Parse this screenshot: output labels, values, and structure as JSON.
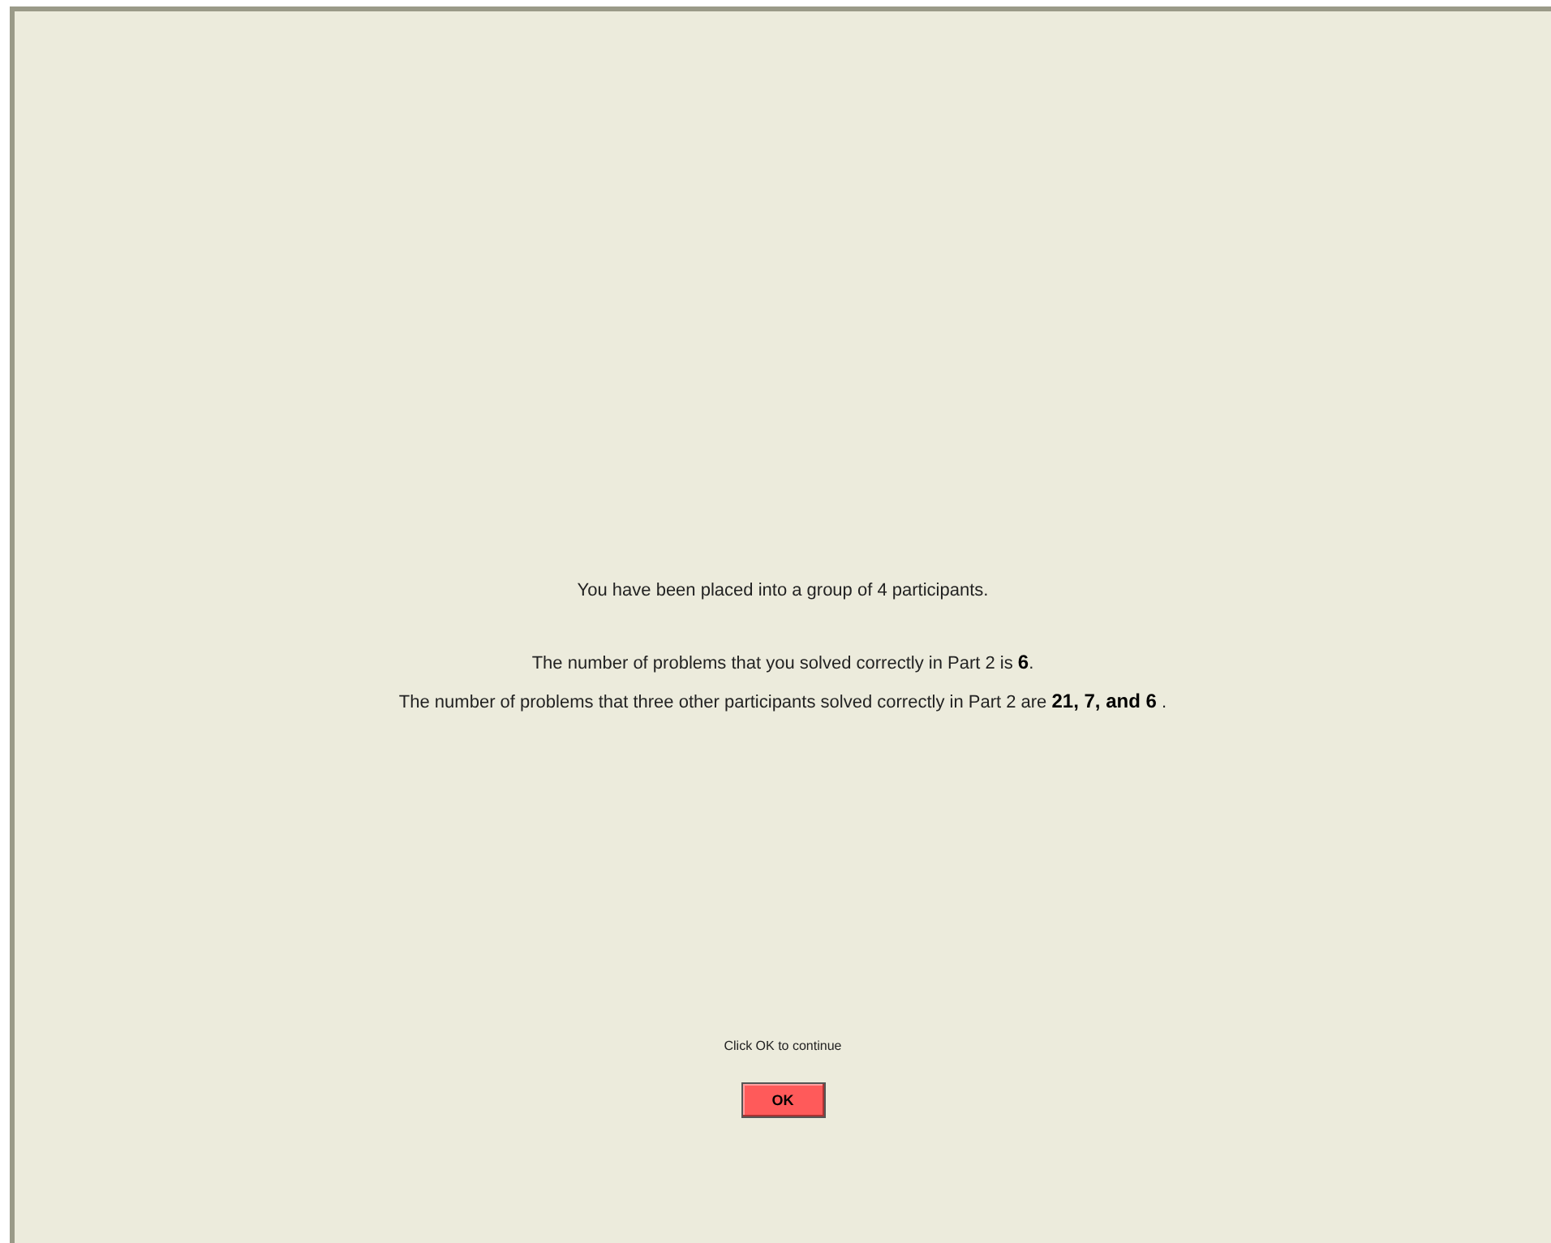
{
  "group_message": "You have been placed into a group of 4 participants.",
  "results": [
    "The number of problems that you solved correctly in Part 2 is **6**.",
    "The number of problems that three other participants solved correctly in Part 2 are **21, 7, and 6** ."
  ],
  "instruction": "Click OK to continue",
  "button": "OK"
}
